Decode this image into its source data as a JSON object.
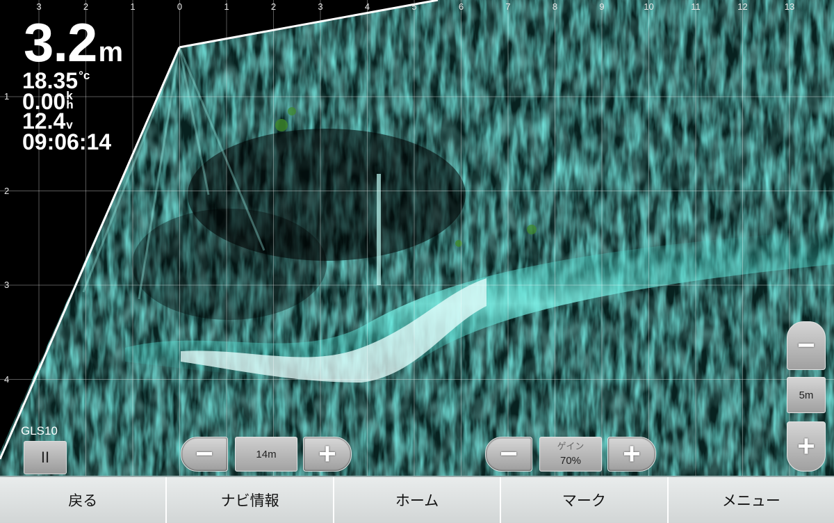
{
  "sonar": {
    "top_ticks": [
      "3",
      "2",
      "1",
      "0",
      "1",
      "2",
      "3",
      "4",
      "5",
      "6",
      "7",
      "8",
      "9",
      "10",
      "11",
      "12",
      "13"
    ],
    "left_ticks": [
      "1",
      "2",
      "3",
      "4"
    ],
    "colors": {
      "echo": "#2fd6c8",
      "echo_strong": "#e8fffd",
      "vegetation": "#3f8a2a",
      "background": "#000000"
    }
  },
  "readouts": {
    "depth_value": "3.2",
    "depth_unit": "m",
    "temperature_value": "18.35",
    "temperature_unit": "°c",
    "speed_value": "0.00",
    "speed_unit_top": "k",
    "speed_unit_bottom": "h",
    "voltage_value": "12.4",
    "voltage_unit": "v",
    "time": "09:06:14"
  },
  "transducer": {
    "label": "GLS10",
    "pause_icon": "pause-icon",
    "pause_symbol": "II"
  },
  "zoom_control": {
    "minus": "−",
    "value": "14m",
    "plus": "+"
  },
  "gain_control": {
    "minus": "−",
    "caption": "ゲイン",
    "value": "70%",
    "plus": "+"
  },
  "range_control": {
    "minus": "−",
    "value": "5m",
    "plus": "+"
  },
  "bottom_bar": {
    "back": "戻る",
    "nav_info": "ナビ情報",
    "home": "ホーム",
    "mark": "マーク",
    "menu": "メニュー"
  }
}
